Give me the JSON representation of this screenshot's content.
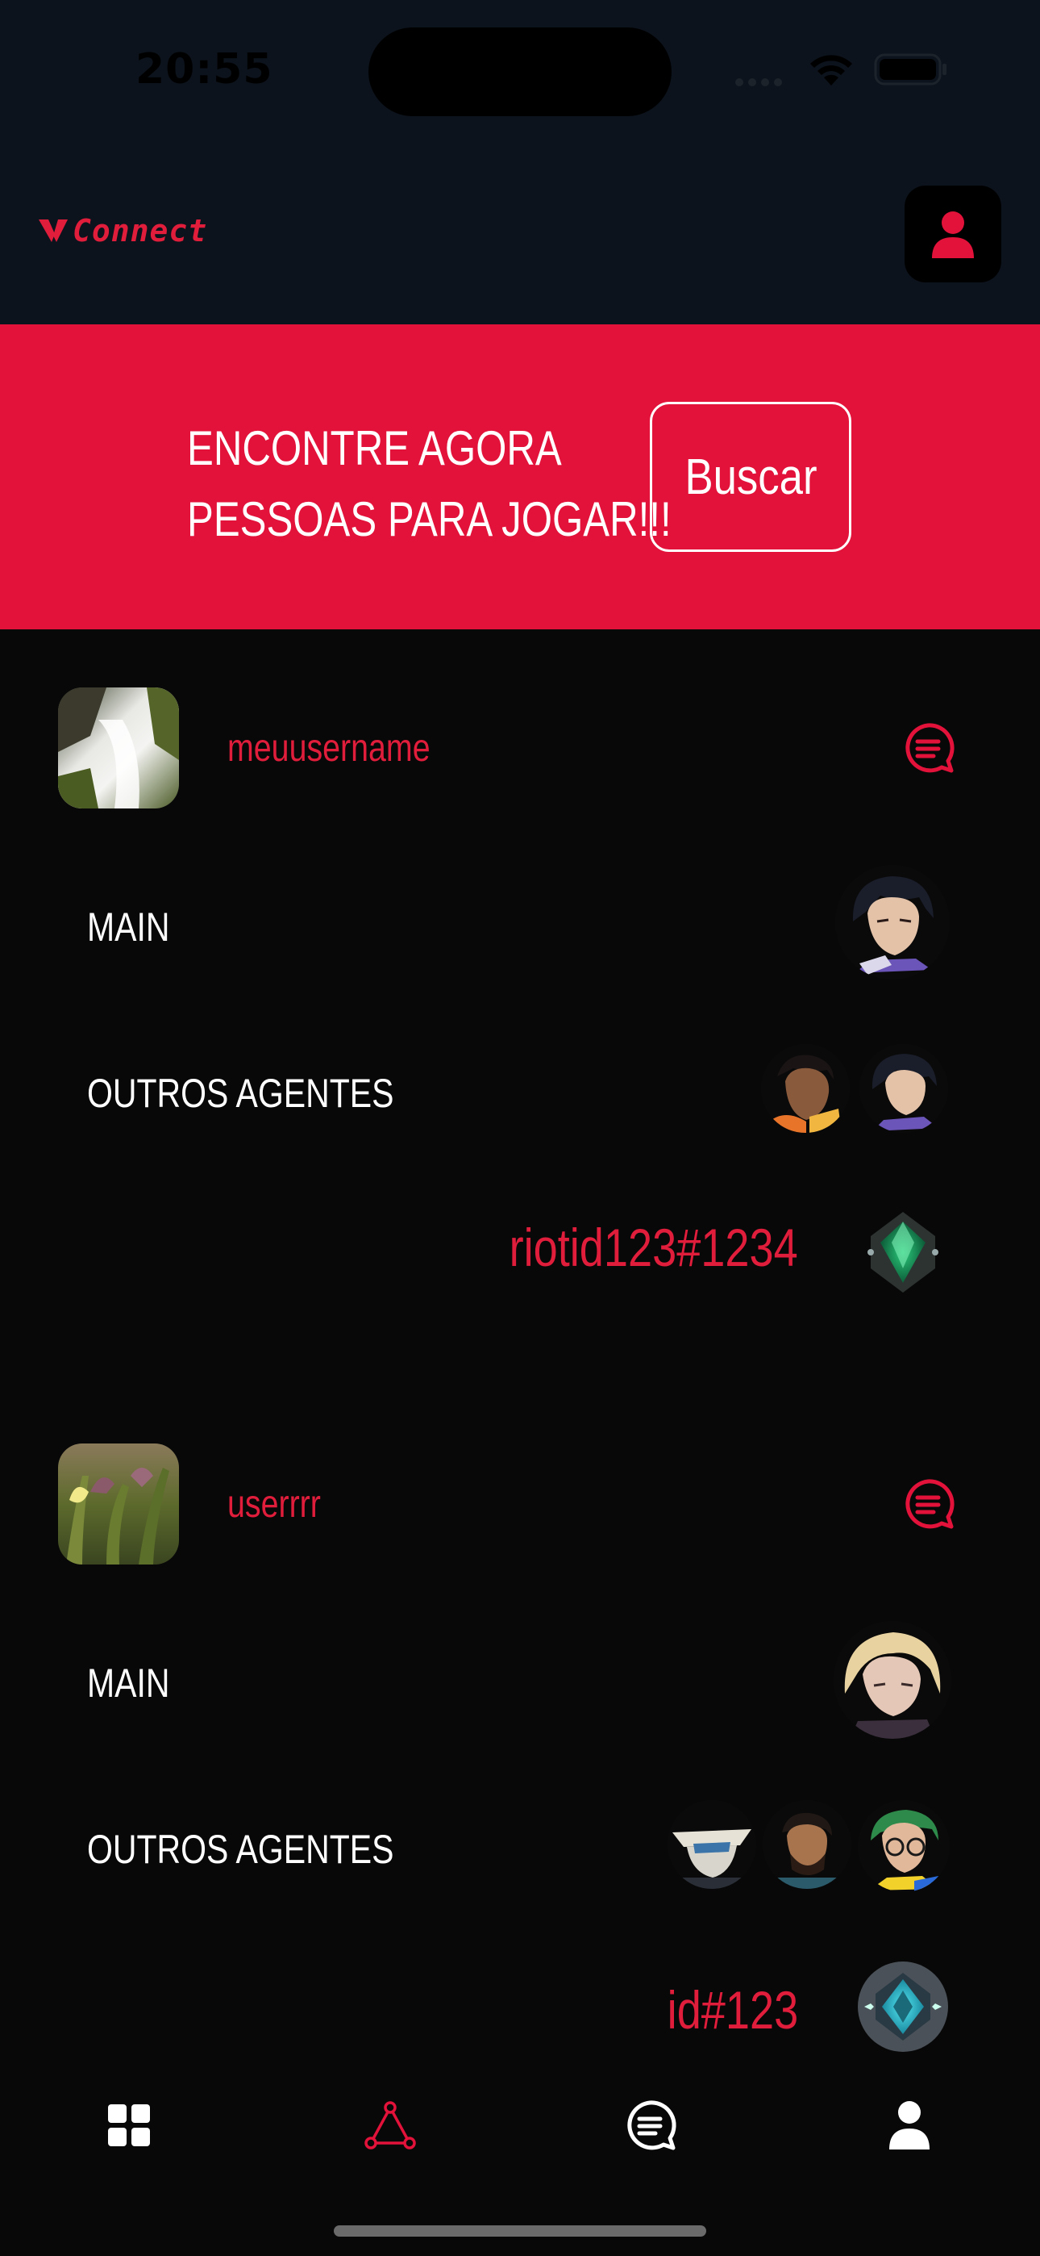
{
  "status_bar": {
    "time": "20:55"
  },
  "header": {
    "logo_text": "Connect"
  },
  "banner": {
    "line1": "ENCONTRE AGORA",
    "line2": "PESSOAS PARA JOGAR!!!",
    "button_label": "Buscar"
  },
  "cards": [
    {
      "username": "meuusername",
      "main_label": "MAIN",
      "others_label": "OUTROS AGENTES",
      "riot_id": "riotid123#1234",
      "rank": "emerald-rank-icon"
    },
    {
      "username": "userrrr",
      "main_label": "MAIN",
      "others_label": "OUTROS AGENTES",
      "riot_id": "id#123",
      "rank": "diamond-rank-icon"
    }
  ],
  "nav": {
    "items": [
      "grid-icon",
      "triangle-network-icon",
      "chat-icon",
      "person-icon"
    ],
    "active": "triangle-network-icon"
  },
  "colors": {
    "accent": "#e2123a",
    "header_bg": "#0c131c",
    "page_bg": "#080808"
  }
}
